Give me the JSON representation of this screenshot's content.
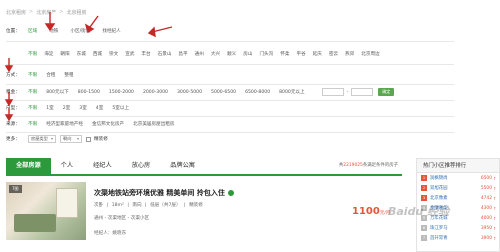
{
  "breadcrumb": [
    "北京租房",
    "北京房产",
    "北京租房"
  ],
  "position": {
    "label": "位置：",
    "tabs": [
      "区域",
      "地铁",
      "小区/街道",
      "找经纪人"
    ]
  },
  "districts": [
    "不限",
    "海淀",
    "朝阳",
    "东城",
    "西城",
    "崇文",
    "宣武",
    "丰台",
    "石景山",
    "昌平",
    "通州",
    "大兴",
    "顺义",
    "房山",
    "门头沟",
    "怀柔",
    "平谷",
    "延庆",
    "密云",
    "燕郊",
    "北京周边"
  ],
  "method": {
    "label": "方式：",
    "options": [
      "不限",
      "合租",
      "整租"
    ]
  },
  "rent": {
    "label": "租金：",
    "options": [
      "不限",
      "800元以下",
      "800-1500",
      "1500-2000",
      "2000-3000",
      "3000-5000",
      "5000-6500",
      "6500-8000",
      "8000元以上"
    ],
    "dash": "-",
    "ok": "确定"
  },
  "layout": {
    "label": "户型：",
    "options": [
      "不限",
      "1室",
      "2室",
      "3室",
      "4室",
      "5室以上"
    ]
  },
  "source": {
    "label": "来源：",
    "options": [
      "不限",
      "经济型家庭地产经",
      "金信邦文化房产",
      "北京美居房屋出租房"
    ]
  },
  "more": {
    "label": "更多：",
    "select1": "房屋类型",
    "select2": "朝向",
    "checkbox": "精装修"
  },
  "list_tabs": [
    "全部房源",
    "个人",
    "经纪人",
    "放心房",
    "品牌公寓"
  ],
  "count_text": {
    "prefix": "共",
    "number": "2219025",
    "suffix": "条满足条件的房子"
  },
  "listing": {
    "badge": "7图",
    "title": "次渠地铁站旁环境优雅 精美单间 拎包入住",
    "meta": [
      "次卧",
      "|",
      "18m²",
      "|",
      "南向",
      "|",
      "低层（共7层）",
      "|",
      "精装修"
    ],
    "location": "通州 - 次渠地区 - 次渠小区",
    "agent": "经纪人：姚晓东",
    "price": "1100",
    "unit": "元/月"
  },
  "sidebar": {
    "title": "热门小区推荐排行",
    "items": [
      {
        "rank": "1",
        "name": "润枫锦尚",
        "price": "6500",
        "arrow": "↑"
      },
      {
        "rank": "2",
        "name": "双旭花园",
        "price": "5500",
        "arrow": "↑"
      },
      {
        "rank": "3",
        "name": "北京像素",
        "price": "4742",
        "arrow": "↑"
      },
      {
        "rank": "4",
        "name": "金隅嘉华",
        "price": "4300",
        "arrow": "↑"
      },
      {
        "rank": "5",
        "name": "万年花城",
        "price": "4000",
        "arrow": "↑"
      },
      {
        "rank": "6",
        "name": "珠江罗马",
        "price": "3950",
        "arrow": "↑"
      },
      {
        "rank": "7",
        "name": "首开常青",
        "price": "3900",
        "arrow": "↑"
      }
    ]
  },
  "watermark": "Baidu 经验",
  "colors": {
    "accent": "#2c9a3c",
    "price": "#e6543a",
    "annotation": "#c62828"
  }
}
